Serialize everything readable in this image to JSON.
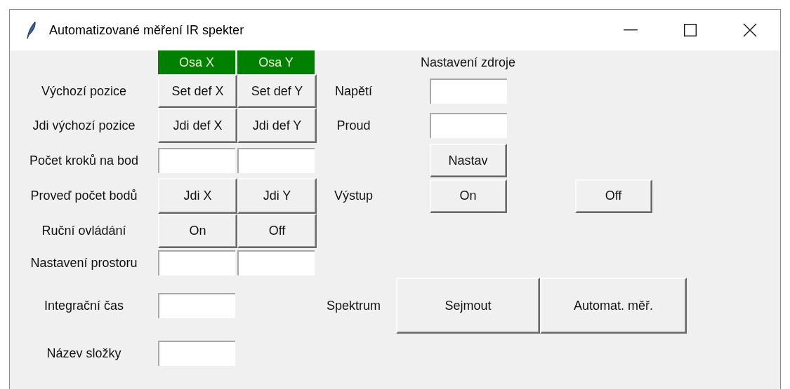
{
  "window": {
    "title": "Automatizované měření IR spekter"
  },
  "axis_headers": [
    {
      "label": "Osa X"
    },
    {
      "label": "Osa Y"
    }
  ],
  "axis_rows": [
    {
      "label": "Výchozí pozice",
      "kind": "buttons",
      "buttons": [
        "Set def X",
        "Set def Y"
      ]
    },
    {
      "label": "Jdi výchozí pozice",
      "kind": "buttons",
      "buttons": [
        "Jdi def X",
        "Jdi def Y"
      ]
    },
    {
      "label": "Počet kroků na bod",
      "kind": "field_pair"
    },
    {
      "label": "Proveď počet bodů",
      "kind": "buttons",
      "buttons": [
        "Jdi X",
        "Jdi Y"
      ]
    },
    {
      "label": "Ruční ovládání",
      "kind": "buttons",
      "buttons": [
        "On",
        "Off"
      ]
    },
    {
      "label": "Nastavení prostoru",
      "kind": "field_pair"
    },
    {
      "label": "Integrační čas",
      "kind": "field"
    },
    {
      "label": "Název složky",
      "kind": "field"
    }
  ],
  "source": {
    "title": "Nastavení zdroje",
    "fields": [
      {
        "label": "Napětí"
      },
      {
        "label": "Proud"
      }
    ],
    "set_button": "Nastav",
    "output": {
      "label": "Výstup",
      "buttons": [
        "On",
        "Off"
      ]
    }
  },
  "spectrum": {
    "label": "Spektrum",
    "buttons": [
      "Sejmout",
      "Automat. měř."
    ]
  }
}
